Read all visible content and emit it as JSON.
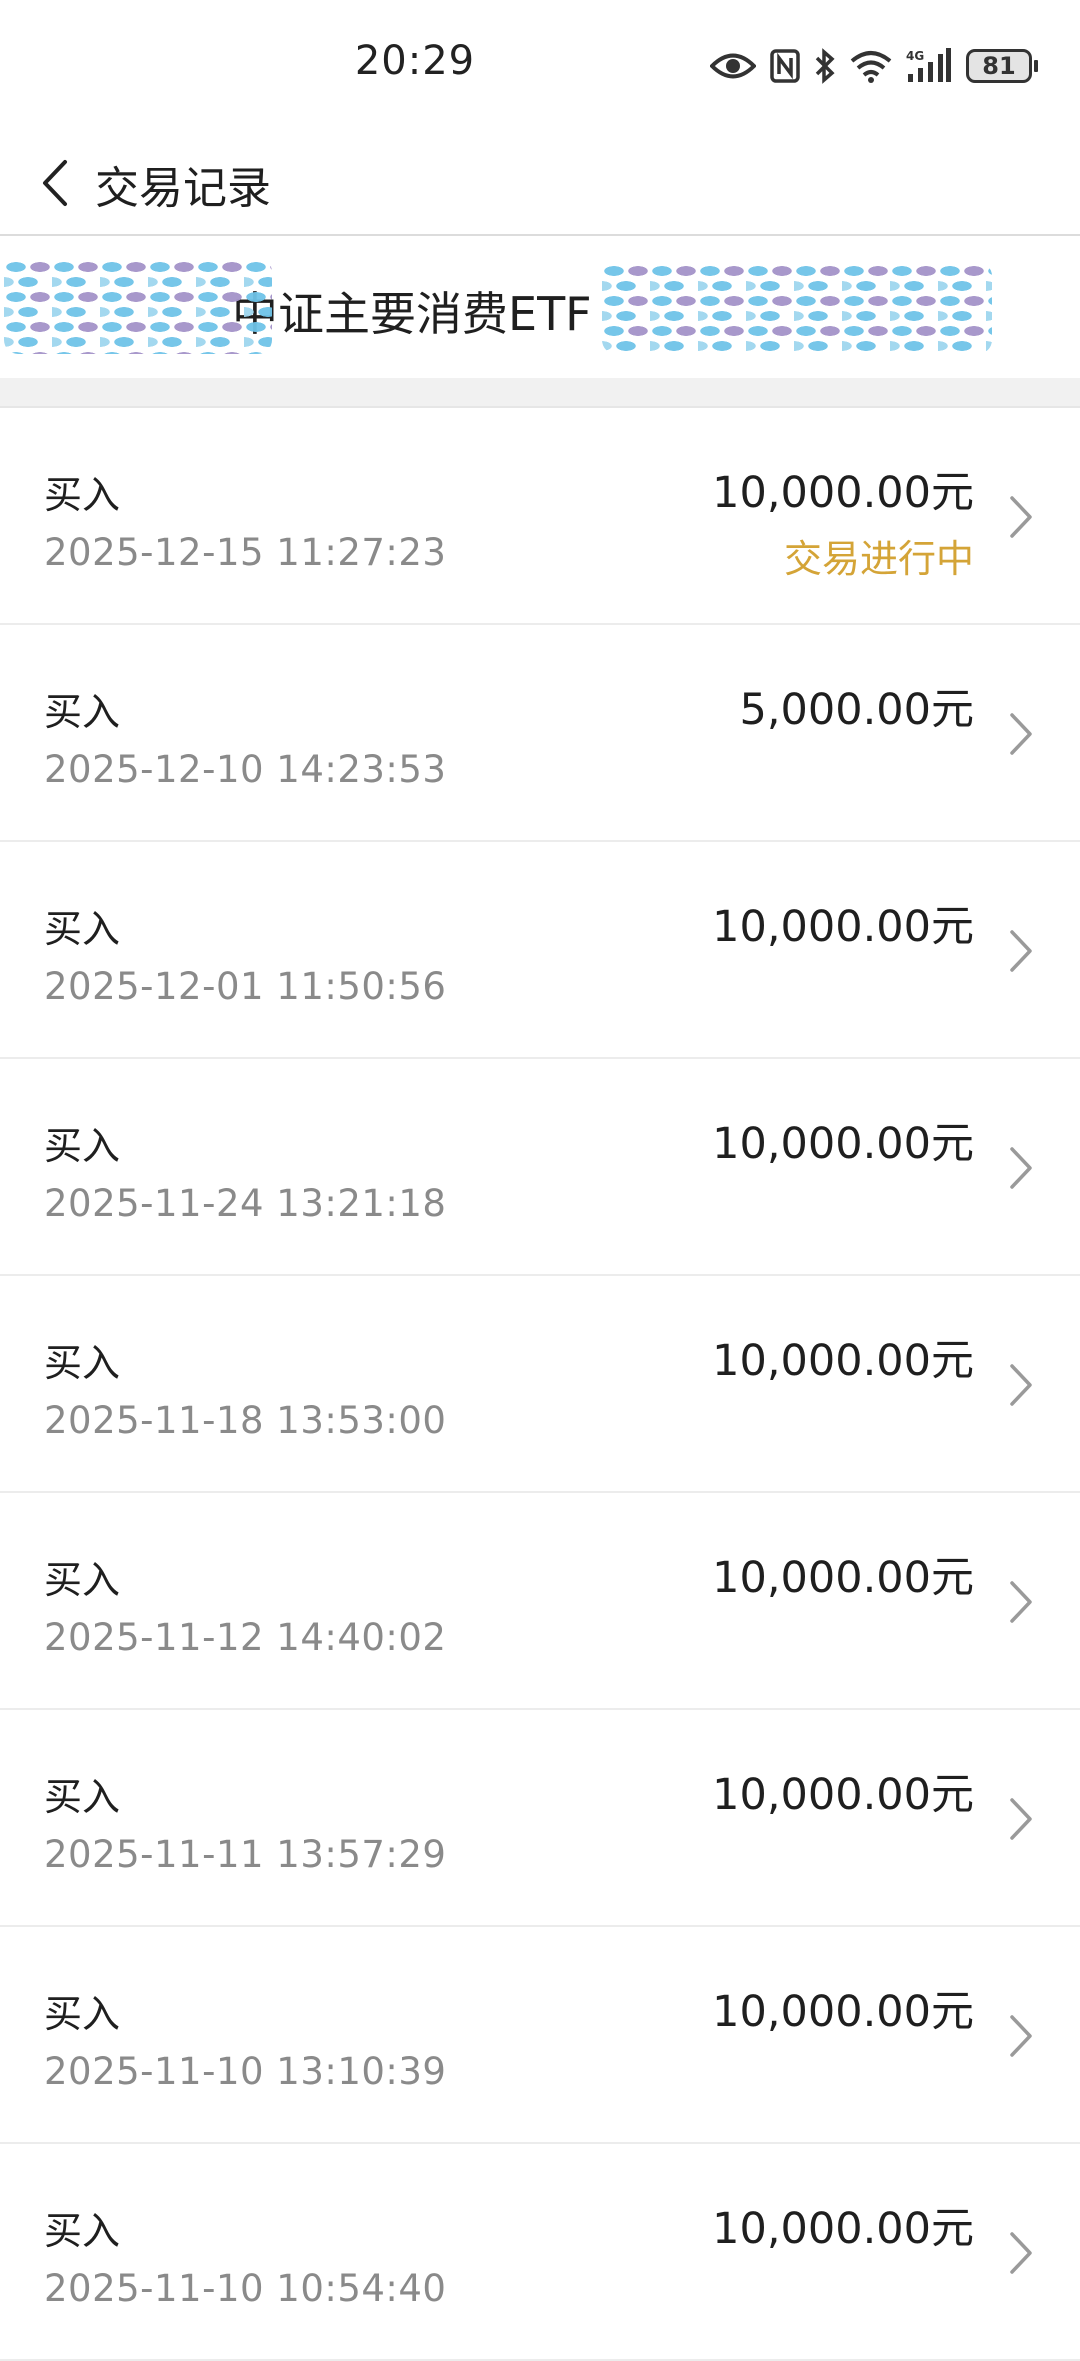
{
  "status_bar": {
    "time": "20:29",
    "battery": "81",
    "icons": [
      "eye-icon",
      "nfc-icon",
      "bluetooth-icon",
      "wifi-icon",
      "4g-signal-icon",
      "battery-icon"
    ]
  },
  "header": {
    "title": "交易记录",
    "back_icon": "chevron-left-icon"
  },
  "fund": {
    "name_visible": "中证主要消费ETF"
  },
  "transactions": [
    {
      "type": "买入",
      "date": "2025-12-15 11:27:23",
      "amount": "10,000.00元",
      "status": "交易进行中"
    },
    {
      "type": "买入",
      "date": "2025-12-10 14:23:53",
      "amount": "5,000.00元",
      "status": ""
    },
    {
      "type": "买入",
      "date": "2025-12-01 11:50:56",
      "amount": "10,000.00元",
      "status": ""
    },
    {
      "type": "买入",
      "date": "2025-11-24 13:21:18",
      "amount": "10,000.00元",
      "status": ""
    },
    {
      "type": "买入",
      "date": "2025-11-18 13:53:00",
      "amount": "10,000.00元",
      "status": ""
    },
    {
      "type": "买入",
      "date": "2025-11-12 14:40:02",
      "amount": "10,000.00元",
      "status": ""
    },
    {
      "type": "买入",
      "date": "2025-11-11 13:57:29",
      "amount": "10,000.00元",
      "status": ""
    },
    {
      "type": "买入",
      "date": "2025-11-10 13:10:39",
      "amount": "10,000.00元",
      "status": ""
    },
    {
      "type": "买入",
      "date": "2025-11-10 10:54:40",
      "amount": "10,000.00元",
      "status": ""
    }
  ],
  "colors": {
    "status_in_progress": "#d4a437",
    "date_text": "#8a8a8a",
    "divider": "#ececec"
  }
}
